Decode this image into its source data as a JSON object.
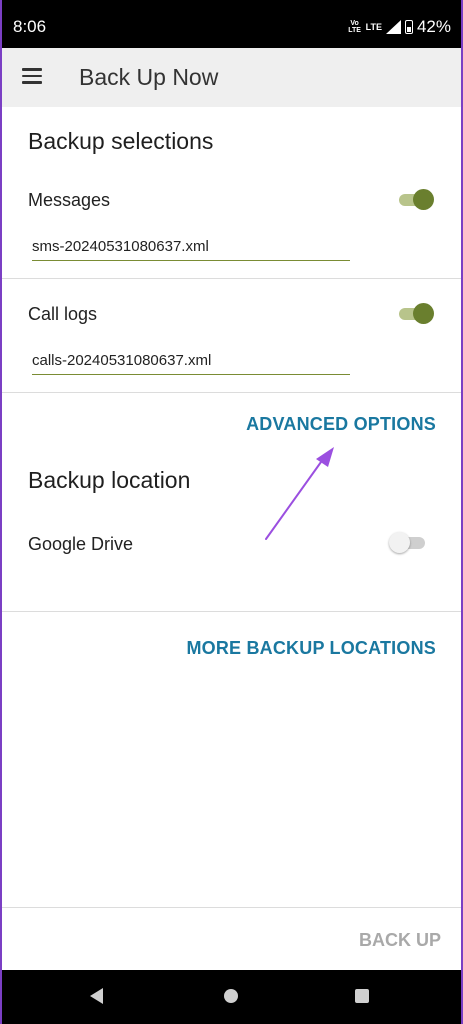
{
  "status_bar": {
    "time": "8:06",
    "volte_line1": "Vo",
    "volte_line2": "LTE",
    "network": "LTE",
    "battery": "42%"
  },
  "app_bar": {
    "menu_icon": "hamburger-menu-icon",
    "title": "Back Up Now"
  },
  "backup_selections": {
    "title": "Backup selections",
    "items": [
      {
        "label": "Messages",
        "enabled": true,
        "filename": "sms-20240531080637.xml"
      },
      {
        "label": "Call logs",
        "enabled": true,
        "filename": "calls-20240531080637.xml"
      }
    ]
  },
  "advanced_options_label": "ADVANCED OPTIONS",
  "backup_location": {
    "title": "Backup location",
    "items": [
      {
        "label": "Google Drive",
        "enabled": false
      }
    ]
  },
  "more_locations_label": "MORE BACKUP LOCATIONS",
  "back_up_label": "BACK UP",
  "colors": {
    "accent": "#1a78a0",
    "toggle_on": "#6a7f2e",
    "disabled_text": "#a9a9a9",
    "annotation_arrow": "#9b4fe0"
  },
  "nav_bar": {
    "back_icon": "back-triangle-icon",
    "home_icon": "home-circle-icon",
    "recents_icon": "recents-square-icon"
  }
}
